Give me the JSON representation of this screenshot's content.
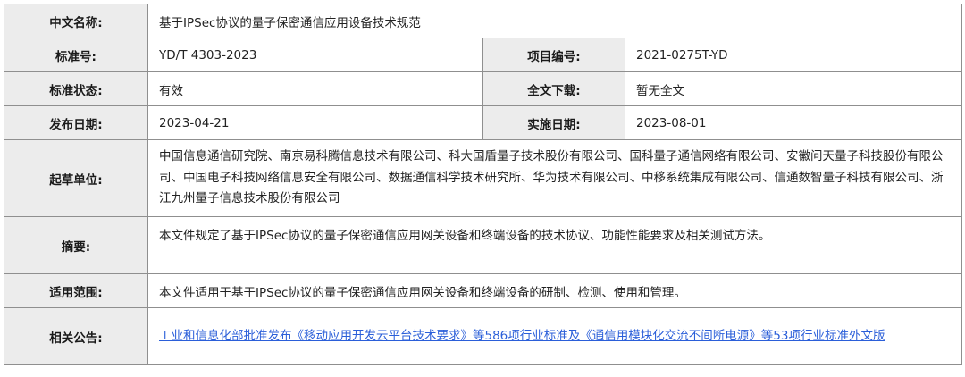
{
  "labels": {
    "name": "中文名称:",
    "standard_no": "标准号:",
    "project_no": "项目编号:",
    "status": "标准状态:",
    "download": "全文下载:",
    "publish_date": "发布日期:",
    "implement_date": "实施日期:",
    "drafters": "起草单位:",
    "abstract": "摘要:",
    "scope": "适用范围:",
    "announcement": "相关公告:"
  },
  "values": {
    "name": "基于IPSec协议的量子保密通信应用设备技术规范",
    "standard_no": "YD/T 4303-2023",
    "project_no": "2021-0275T-YD",
    "status": "有效",
    "download": "暂无全文",
    "publish_date": "2023-04-21",
    "implement_date": "2023-08-01",
    "drafters": "中国信息通信研究院、南京易科腾信息技术有限公司、科大国盾量子技术股份有限公司、国科量子通信网络有限公司、安徽问天量子科技股份有限公司、中国电子科技网络信息安全有限公司、数据通信科学技术研究所、华为技术有限公司、中移系统集成有限公司、信通数智量子科技有限公司、浙江九州量子信息技术股份有限公司",
    "abstract": "本文件规定了基于IPSec协议的量子保密通信应用网关设备和终端设备的技术协议、功能性能要求及相关测试方法。",
    "scope": "本文件适用于基于IPSec协议的量子保密通信应用网关设备和终端设备的研制、检测、使用和管理。",
    "announcement_link": "工业和信息化部批准发布《移动应用开发云平台技术要求》等586项行业标准及《通信用模块化交流不间断电源》等53项行业标准外文版"
  }
}
